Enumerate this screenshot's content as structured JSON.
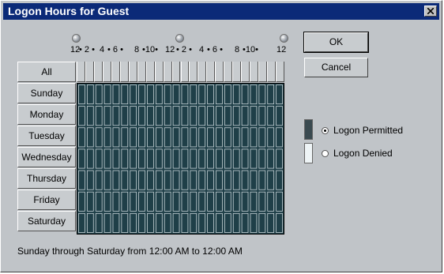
{
  "window": {
    "title": "Logon Hours for Guest",
    "close_icon": "close-icon"
  },
  "hour_labels": [
    "12",
    "• 2 •",
    "4",
    "• 6 •",
    "8",
    "•10•",
    "12",
    "• 2 •",
    "4",
    "• 6 •",
    "8",
    "•10•",
    "12"
  ],
  "all_label": "All",
  "days": [
    "Sunday",
    "Monday",
    "Tuesday",
    "Wednesday",
    "Thursday",
    "Friday",
    "Saturday"
  ],
  "buttons": {
    "ok": "OK",
    "cancel": "Cancel"
  },
  "legend": {
    "permitted": {
      "label": "Logon Permitted",
      "checked": true,
      "color": "#3a4a50"
    },
    "denied": {
      "label": "Logon Denied",
      "checked": false,
      "color": "#eef4f6"
    }
  },
  "summary": "Sunday through Saturday from 12:00 AM to 12:00 AM",
  "colors": {
    "titlebar": "#0b2a78",
    "grid_permitted": "#1f3f48",
    "grid_lines": "#c8d4d8"
  }
}
